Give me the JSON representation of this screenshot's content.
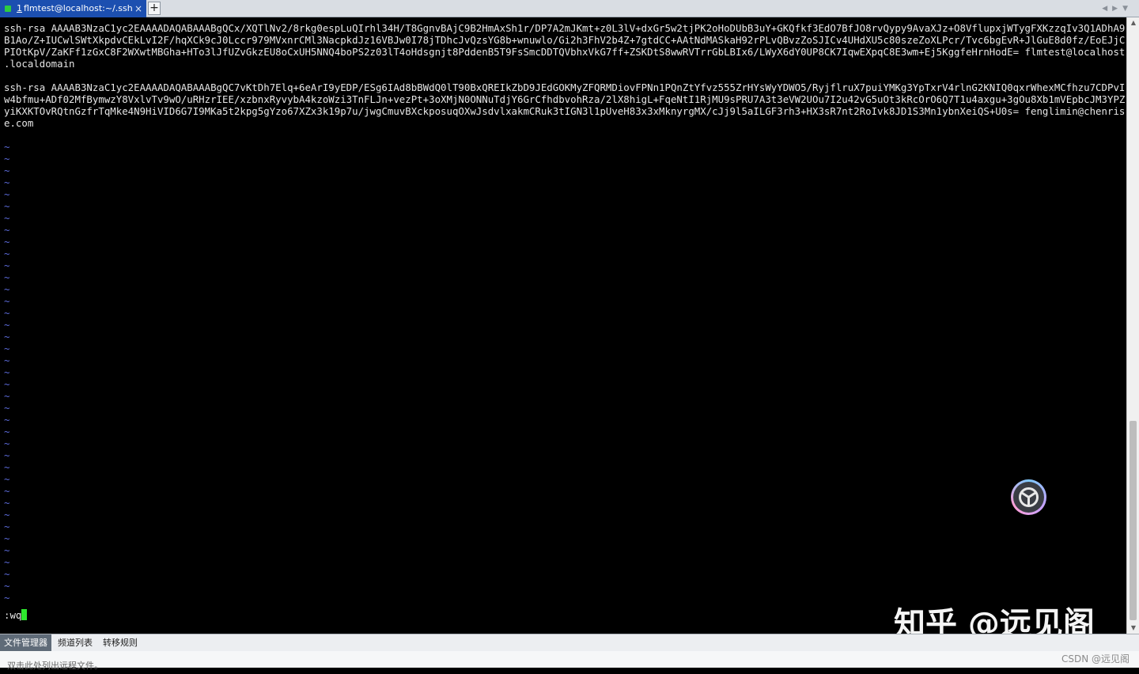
{
  "tab": {
    "number": "1",
    "title": "flmtest@localhost:~/.ssh",
    "close_glyph": "×",
    "new_tab_glyph": "+",
    "status_color": "#2ecc40"
  },
  "nav": {
    "left_glyph": "◀",
    "right_glyph": "▶",
    "menu_glyph": "▼"
  },
  "terminal": {
    "lines": [
      "ssh-rsa AAAAB3NzaC1yc2EAAAADAQABAAABgQCx/XQTlNv2/8rkg0espLuQIrhl34H/T8GgnvBAjC9B2HmAxSh1r/DP7A2mJKmt+z0L3lV+dxGr5w2tjPK2oHoDUbB3uY+GKQfkf3EdO7BfJO8rvQypy9AvaXJz+O8VflupxjWTygFXKzzqIv3Q1ADhA9",
      "B1Ao/Z+IUCwlSWtXkpdvCEkLvI2F/hqXCk9cJ0Lccr979MVxnrCMl3NacpkdJz16VBJw0I78jTDhcJvQzsYG8b+wnuwlo/Gi2h3FhV2b4Z+7gtdCC+AAtNdMASkaH92rPLvQBvzZoSJICv4UHdXU5c80szeZoXLPcr/Tvc6bgEvR+JlGuE8d0fz/EoEJjC",
      "PIOtKpV/ZaKFf1zGxC8F2WXwtMBGha+HTo3lJfUZvGkzEU8oCxUH5NNQ4boPS2z03lT4oHdsgnjt8PddenB5T9FsSmcDDTQVbhxVkG7ff+ZSKDtS8wwRVTrrGbLBIx6/LWyX6dY0UP8CK7IqwEXpqC8E3wm+Ej5KggfeHrnHodE= flmtest@localhost",
      ".localdomain",
      "",
      "ssh-rsa AAAAB3NzaC1yc2EAAAADAQABAAABgQC7vKtDh7Elq+6eArI9yEDP/ESg6IAd8bBWdQ0lT90BxQREIkZbD9JEdGOKMyZFQRMDiovFPNn1PQnZtYfvz555ZrHYsWyYDWO5/RyjflruX7puiYMKg3YpTxrV4rlnG2KNIQ0qxrWhexMCfhzu7CDPvI",
      "w4bfmu+ADf02MfBymwzY8VxlvTv9wO/uRHzrIEE/xzbnxRyvybA4kzoWzi3TnFLJn+vezPt+3oXMjN0ONNuTdjY6GrCfhdbvohRza/2lX8higL+FqeNtI1RjMU9sPRU7A3t3eVW2UOu7I2u42vG5uOt3kRcOrO6Q7T1u4axgu+3gOu8Xb1mVEpbcJM3YPZ",
      "yiKXKTOvRQtnGzfrTqMke4N9HiVID6G7I9MKa5t2kpg5gYzo67XZx3k19p7u/jwgCmuvBXckposuqOXwJsdvlxakmCRuk3tIGN3l1pUveH83x3xMknyrgMX/cJj9l5aILGF3rh3+HX3sR7nt2RoIvk8JD1S3Mn1ybnXeiQS+U0s= fenglimin@chenris",
      "e.com",
      ""
    ],
    "tilde": "~",
    "tilde_count": 39,
    "command": ":wq",
    "cursor_color": "#2ee82e"
  },
  "scrollbar": {
    "up_glyph": "▲",
    "down_glyph": "▼"
  },
  "float_button": {
    "icon": "branch-logo-icon"
  },
  "watermark": "知乎 @远见阁",
  "bottom_tabs": [
    {
      "label": "文件管理器",
      "active": true
    },
    {
      "label": "频道列表",
      "active": false
    },
    {
      "label": "转移规则",
      "active": false
    }
  ],
  "status": {
    "hint": "双击此处列出远程文件。",
    "credit": "CSDN @远见阁"
  }
}
